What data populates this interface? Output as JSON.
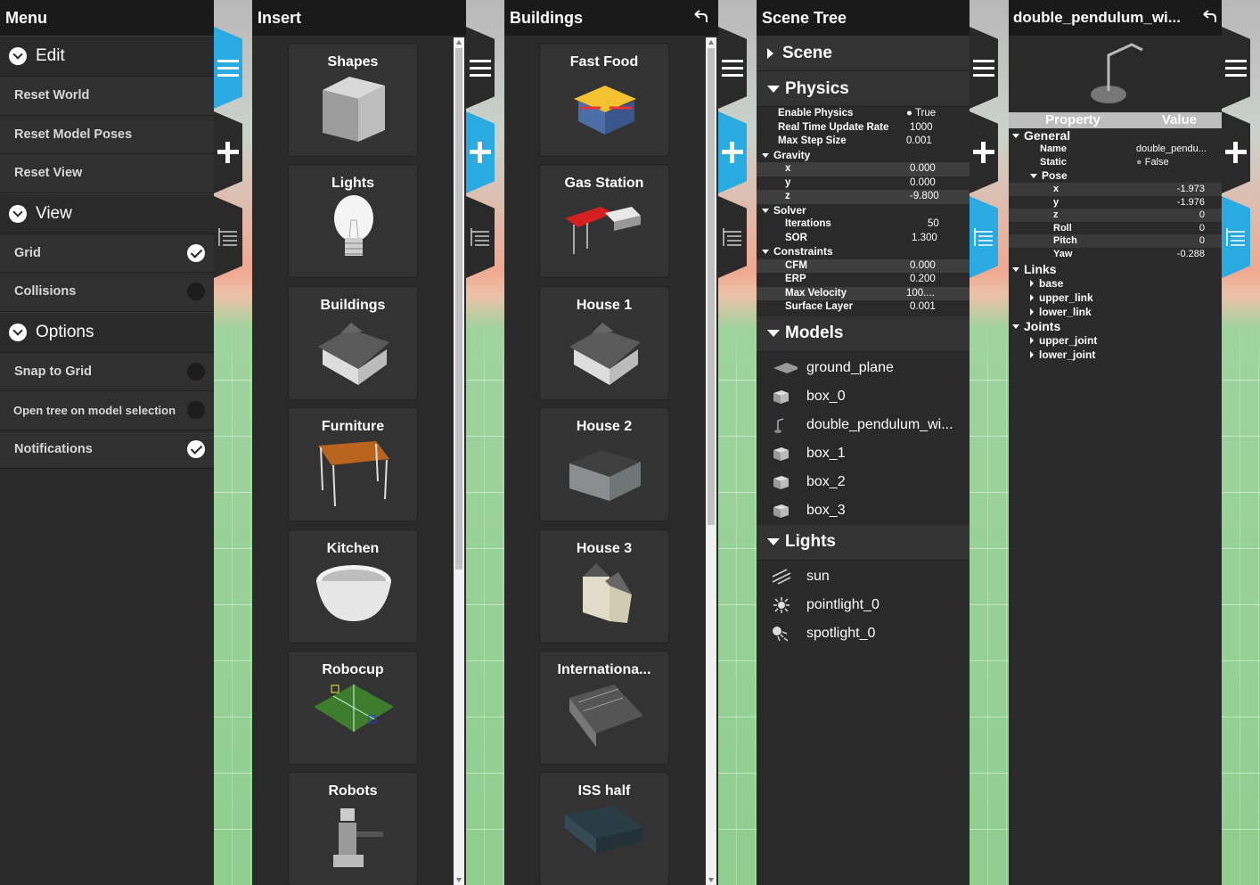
{
  "menu": {
    "title": "Menu",
    "sections": [
      {
        "label": "Edit",
        "items": [
          {
            "label": "Reset World"
          },
          {
            "label": "Reset Model Poses"
          },
          {
            "label": "Reset View"
          }
        ]
      },
      {
        "label": "View",
        "items": [
          {
            "label": "Grid",
            "checked": true
          },
          {
            "label": "Collisions",
            "checked": false
          }
        ]
      },
      {
        "label": "Options",
        "items": [
          {
            "label": "Snap to Grid",
            "checked": false
          },
          {
            "label": "Open tree on model selection",
            "checked": false
          },
          {
            "label": "Notifications",
            "checked": true
          }
        ]
      }
    ]
  },
  "insert": {
    "title": "Insert",
    "categories": [
      "Shapes",
      "Lights",
      "Buildings",
      "Furniture",
      "Kitchen",
      "Robocup",
      "Robots"
    ]
  },
  "buildings": {
    "title": "Buildings",
    "models": [
      "Fast Food",
      "Gas Station",
      "House 1",
      "House 2",
      "House 3",
      "Internationa...",
      "ISS half"
    ]
  },
  "scene_tree": {
    "title": "Scene Tree",
    "scene_label": "Scene",
    "physics_label": "Physics",
    "physics": {
      "enable_physics": {
        "label": "Enable Physics",
        "value": "True"
      },
      "rt_update_rate": {
        "label": "Real Time Update Rate",
        "value": "1000"
      },
      "max_step_size": {
        "label": "Max Step Size",
        "value": "0.001"
      },
      "gravity_label": "Gravity",
      "gravity": [
        {
          "k": "x",
          "v": "0.000"
        },
        {
          "k": "y",
          "v": "0.000"
        },
        {
          "k": "z",
          "v": "-9.800"
        }
      ],
      "solver_label": "Solver",
      "solver": [
        {
          "k": "Iterations",
          "v": "50"
        },
        {
          "k": "SOR",
          "v": "1.300"
        }
      ],
      "constraints_label": "Constraints",
      "constraints": [
        {
          "k": "CFM",
          "v": "0.000"
        },
        {
          "k": "ERP",
          "v": "0.200"
        },
        {
          "k": "Max Velocity",
          "v": "100...."
        },
        {
          "k": "Surface Layer",
          "v": "0.001"
        }
      ]
    },
    "models_label": "Models",
    "models": [
      "ground_plane",
      "box_0",
      "double_pendulum_wi...",
      "box_1",
      "box_2",
      "box_3"
    ],
    "lights_label": "Lights",
    "lights": [
      "sun",
      "pointlight_0",
      "spotlight_0"
    ]
  },
  "inspector": {
    "title": "double_pendulum_wi...",
    "col_property": "Property",
    "col_value": "Value",
    "general_label": "General",
    "name_label": "Name",
    "name_value": "double_pendu...",
    "static_label": "Static",
    "static_value": "False",
    "pose_label": "Pose",
    "pose": [
      {
        "k": "x",
        "v": "-1.973"
      },
      {
        "k": "y",
        "v": "-1.976"
      },
      {
        "k": "z",
        "v": "0"
      },
      {
        "k": "Roll",
        "v": "0"
      },
      {
        "k": "Pitch",
        "v": "0"
      },
      {
        "k": "Yaw",
        "v": "-0.288"
      }
    ],
    "links_label": "Links",
    "links": [
      "base",
      "upper_link",
      "lower_link"
    ],
    "joints_label": "Joints",
    "joints": [
      "upper_joint",
      "lower_joint"
    ]
  },
  "colors": {
    "panel": "#2a2a2a",
    "title_bar": "#1a1a1a",
    "accent": "#29abe2"
  }
}
